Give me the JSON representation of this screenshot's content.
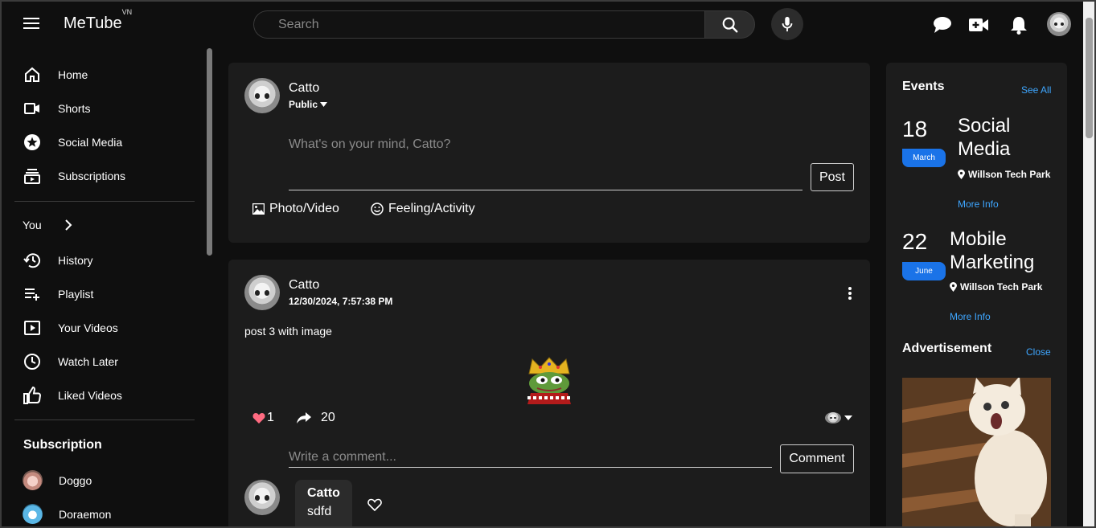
{
  "app": {
    "name": "MeTube",
    "badge": "VN"
  },
  "search": {
    "placeholder": "Search"
  },
  "sidebar": {
    "main": [
      {
        "label": "Home",
        "icon": "home-icon"
      },
      {
        "label": "Shorts",
        "icon": "shorts-icon"
      },
      {
        "label": "Social Media",
        "icon": "star-icon"
      },
      {
        "label": "Subscriptions",
        "icon": "subscriptions-icon"
      }
    ],
    "you_label": "You",
    "you_items": [
      {
        "label": "History",
        "icon": "history-icon"
      },
      {
        "label": "Playlist",
        "icon": "playlist-add-icon"
      },
      {
        "label": "Your Videos",
        "icon": "your-videos-icon"
      },
      {
        "label": "Watch Later",
        "icon": "clock-icon"
      },
      {
        "label": "Liked Videos",
        "icon": "thumbs-up-icon"
      }
    ],
    "subscription_title": "Subscription",
    "subscriptions": [
      {
        "label": "Doggo"
      },
      {
        "label": "Doraemon"
      }
    ]
  },
  "composer": {
    "user": "Catto",
    "privacy": "Public",
    "placeholder": "What's on your mind, Catto?",
    "post_label": "Post",
    "photo_label": "Photo/Video",
    "feeling_label": "Feeling/Activity"
  },
  "post": {
    "user": "Catto",
    "timestamp": "12/30/2024, 7:57:38 PM",
    "text": "post 3 with image",
    "likes": "1",
    "shares": "20",
    "comment_placeholder": "Write a comment...",
    "comment_label": "Comment",
    "comment": {
      "user": "Catto",
      "text": "sdfd"
    }
  },
  "events": {
    "title": "Events",
    "see_all": "See All",
    "items": [
      {
        "day": "18",
        "month": "March",
        "name_line1": "Social",
        "name_line2": "Media",
        "location": "Willson Tech Park",
        "more": "More Info"
      },
      {
        "day": "22",
        "month": "June",
        "name_line1": "Mobile",
        "name_line2": "Marketing",
        "location": "Willson Tech Park",
        "more": "More Info"
      }
    ]
  },
  "advertisement": {
    "title": "Advertisement",
    "close": "Close"
  },
  "colors": {
    "accent": "#3ea6ff",
    "badge_blue": "#1a73e8",
    "like_red": "#ff6b81",
    "card": "#1c1c1c",
    "bg": "#0f0f0f"
  }
}
